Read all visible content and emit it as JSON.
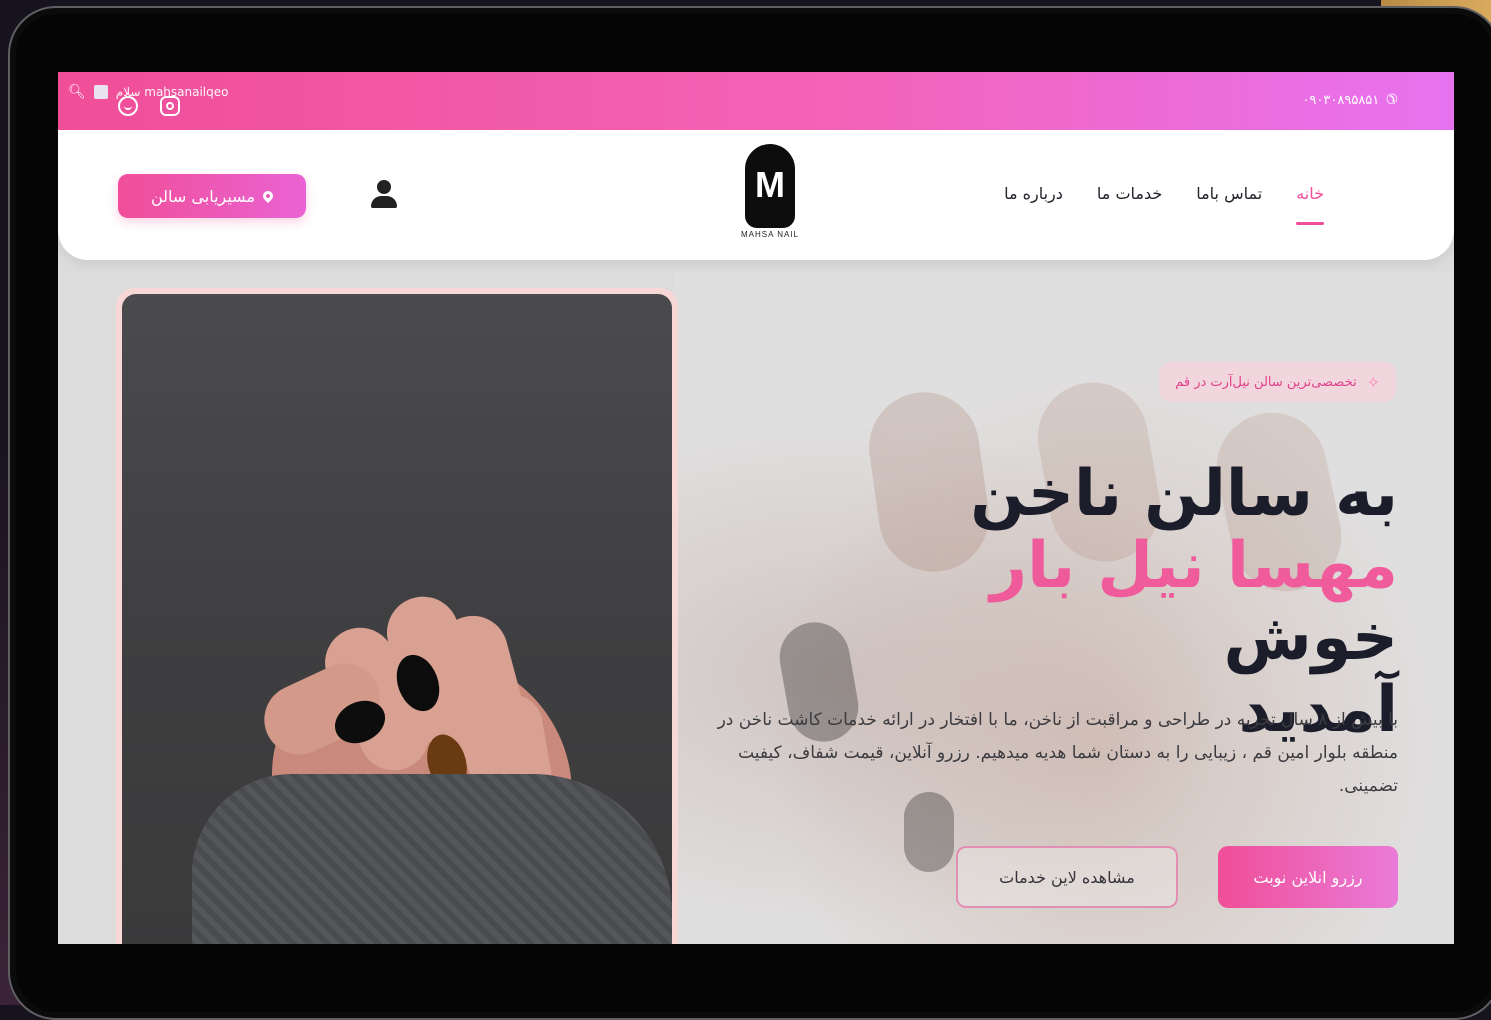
{
  "topbar": {
    "phone": "۰۹۰۳۰۸۹۵۸۵۱",
    "greeting": "سلام mahsanailqeo",
    "phone_icon": "phone-icon",
    "search_icon": "search-icon",
    "social_icons": [
      "whatsapp-icon",
      "instagram-icon"
    ]
  },
  "nav": {
    "items": [
      "خانه",
      "تماس باما",
      "خدمات ما",
      "درباره ما"
    ],
    "active_index": 0
  },
  "logo": {
    "mark": "M",
    "text": "MAHSA NAIL"
  },
  "header": {
    "route_button": "مسیریابی سالن",
    "user_icon": "user-icon"
  },
  "hero": {
    "tagline": "تخصصی‌ترین سالن نیل‌آرت در قم",
    "title_line1": "به سالن ناخن",
    "title_pink1": "مهسا نیل",
    "title_pink2": "بار",
    "title_tail": "خوش",
    "title_line3": "آمدید",
    "description": "با بیش از ۸ سال تجربه در طراحی و مراقبت از ناخن، ما با افتخار در ارائه خدمات کاشت ناخن در منطقه بلوار امین قم ، زیبایی را به دستان شما هدیه میدهیم. رزرو آنلاین، قیمت شفاف، کیفیت تضمینی.",
    "primary_button": "رزرو انلاین نوبت",
    "secondary_button": "مشاهده لاین خدمات"
  },
  "colors": {
    "accent": "#f04e98",
    "accent2": "#e772f0",
    "dark_text": "#1c1d2b"
  }
}
